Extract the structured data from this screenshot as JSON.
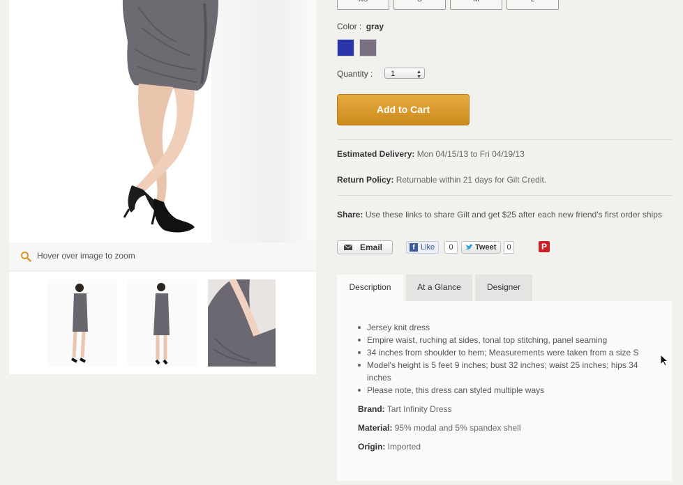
{
  "gallery": {
    "zoom_hint": "Hover over image to zoom",
    "thumbnails": [
      "front-view",
      "back-view",
      "detail-view"
    ]
  },
  "product": {
    "sizes": [
      "XS",
      "S",
      "M",
      "L"
    ],
    "color_label": "Color :",
    "color_value": "gray",
    "swatches": [
      {
        "name": "blue",
        "hex": "#2a36a8"
      },
      {
        "name": "gray",
        "hex": "#7a7082"
      }
    ],
    "quantity_label": "Quantity :",
    "quantity_value": "1",
    "add_to_cart": "Add to Cart",
    "delivery_label": "Estimated Delivery:",
    "delivery_value": "Mon 04/15/13 to Fri 04/19/13",
    "return_label": "Return Policy:",
    "return_value": "Returnable within 21 days for Gilt Credit."
  },
  "share": {
    "label": "Share:",
    "text": "Use these links to share Gilt and get $25 after each new friend's first order ships",
    "email": "Email",
    "like": "Like",
    "like_count": "0",
    "tweet": "Tweet",
    "tweet_count": "0"
  },
  "tabs": [
    "Description",
    "At a Glance",
    "Designer"
  ],
  "description": {
    "bullets": [
      "Jersey knit dress",
      "Empire waist, ruching at sides, tonal top stitching, panel seaming",
      "34 inches from shoulder to hem; Measurements were taken from a size S",
      "Model's height is 5 feet 9 inches; bust 32 inches; waist 25 inches; hips 34 inches",
      "Please note, this dress can styled multiple ways"
    ],
    "brand_label": "Brand:",
    "brand_value": "Tart Infinity Dress",
    "material_label": "Material:",
    "material_value": "95% modal and 5% spandex shell",
    "origin_label": "Origin:",
    "origin_value": "Imported"
  },
  "colors": {
    "accent": "#d89a2c",
    "page_bg": "#f1f1ee"
  }
}
